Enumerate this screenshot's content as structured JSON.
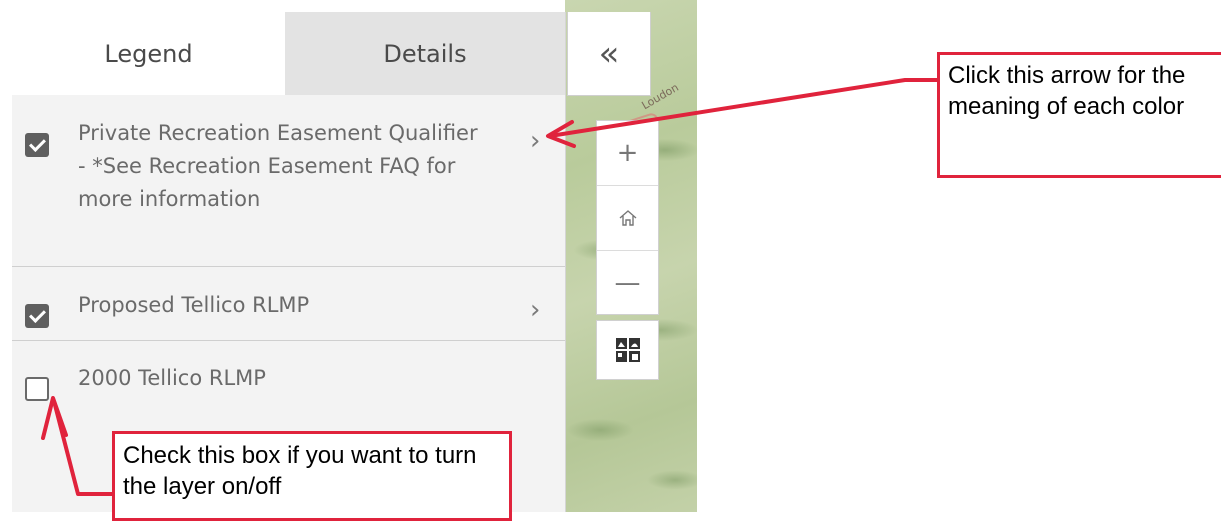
{
  "tabs": {
    "legend": "Legend",
    "details": "Details"
  },
  "collapse_icon": "«",
  "layers": [
    {
      "label": "Private Recreation Easement Qualifier - *See Recreation Easement FAQ for more information",
      "checked": true
    },
    {
      "label": "Proposed Tellico RLMP",
      "checked": true
    },
    {
      "label": "2000 Tellico RLMP",
      "checked": false
    }
  ],
  "chevron": "›",
  "map": {
    "place_label": "Loudon",
    "zoom_in": "+",
    "home": "⌂",
    "zoom_out": "—"
  },
  "annotations": {
    "arrow_callout": "Click this arrow for the meaning of each color",
    "checkbox_callout": "Check this box if you want to turn the layer on/off"
  },
  "colors": {
    "callout_border": "#e0233c",
    "panel_bg": "#f3f3f3",
    "checkbox_checked": "#5f5f5f"
  }
}
